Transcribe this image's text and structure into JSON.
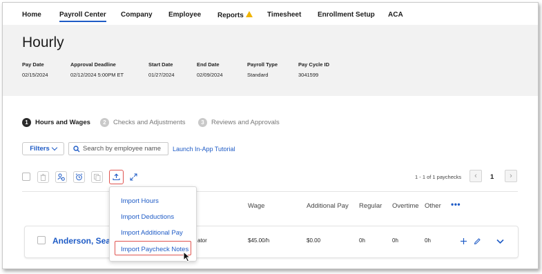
{
  "nav": {
    "items": [
      {
        "label": "Home",
        "active": false
      },
      {
        "label": "Payroll Center",
        "active": true
      },
      {
        "label": "Company",
        "active": false
      },
      {
        "label": "Employee",
        "active": false
      },
      {
        "label": "Reports",
        "active": false,
        "icon": "warning-icon"
      },
      {
        "label": "Timesheet",
        "active": false
      },
      {
        "label": "Enrollment Setup",
        "active": false
      },
      {
        "label": "ACA",
        "active": false
      }
    ]
  },
  "header": {
    "title": "Hourly",
    "meta": [
      {
        "label": "Pay Date",
        "value": "02/15/2024"
      },
      {
        "label": "Approval Deadline",
        "value": "02/12/2024 5:00PM ET"
      },
      {
        "label": "Start Date",
        "value": "01/27/2024"
      },
      {
        "label": "End Date",
        "value": "02/09/2024"
      },
      {
        "label": "Payroll Type",
        "value": "Standard"
      },
      {
        "label": "Pay Cycle ID",
        "value": "3041599"
      }
    ]
  },
  "steps": [
    {
      "number": "1",
      "label": "Hours and Wages",
      "active": true
    },
    {
      "number": "2",
      "label": "Checks and Adjustments",
      "active": false
    },
    {
      "number": "3",
      "label": "Reviews and Approvals",
      "active": false
    }
  ],
  "filters": {
    "label": "Filters",
    "search_placeholder": "Search by employee name",
    "tutorial_link": "Launch In-App Tutorial"
  },
  "pager": {
    "summary": "1 - 1 of 1 paychecks",
    "current_page": "1"
  },
  "table": {
    "headers": [
      "Wage",
      "Additional Pay",
      "Regular",
      "Overtime",
      "Other"
    ],
    "more_label": "•••",
    "rows": [
      {
        "name": "Anderson, Sean",
        "role_fragment": "ator",
        "wage": "$45.00/h",
        "additional_pay": "$0.00",
        "regular": "0h",
        "overtime": "0h",
        "other": "0h"
      }
    ]
  },
  "import_menu": {
    "items": [
      "Import Hours",
      "Import Deductions",
      "Import Additional Pay",
      "Import Paycheck Notes"
    ],
    "highlighted": "Import Paycheck Notes"
  },
  "colors": {
    "accent": "#1e5bc6",
    "highlight": "#e0534f",
    "warning": "#f0b400",
    "header_bg": "#f2f2f2"
  }
}
